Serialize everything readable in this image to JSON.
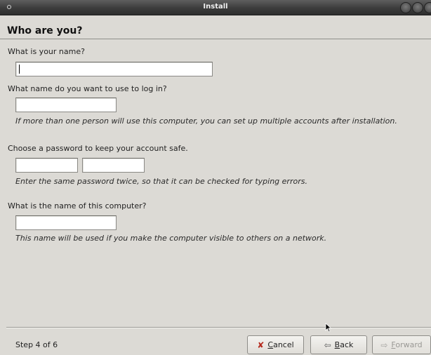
{
  "window": {
    "title": "Install"
  },
  "page": {
    "title": "Who are you?"
  },
  "name_section": {
    "label": "What is your name?",
    "value": ""
  },
  "login_section": {
    "label": "What name do you want to use to log in?",
    "value": "",
    "hint": "If more than one person will use this computer, you can set up multiple accounts after installation."
  },
  "password_section": {
    "label": "Choose a password to keep your account safe.",
    "password": "",
    "confirm": "",
    "hint": "Enter the same password twice, so that it can be checked for typing errors."
  },
  "computer_section": {
    "label": "What is the name of this computer?",
    "value": "",
    "hint": "This name will be used if you make the computer visible to others on a network."
  },
  "footer": {
    "step": "Step 4 of 6",
    "cancel": {
      "mnemonic": "C",
      "rest": "ancel"
    },
    "back": {
      "mnemonic": "B",
      "rest": "ack"
    },
    "forward": {
      "mnemonic": "F",
      "rest": "orward"
    }
  }
}
